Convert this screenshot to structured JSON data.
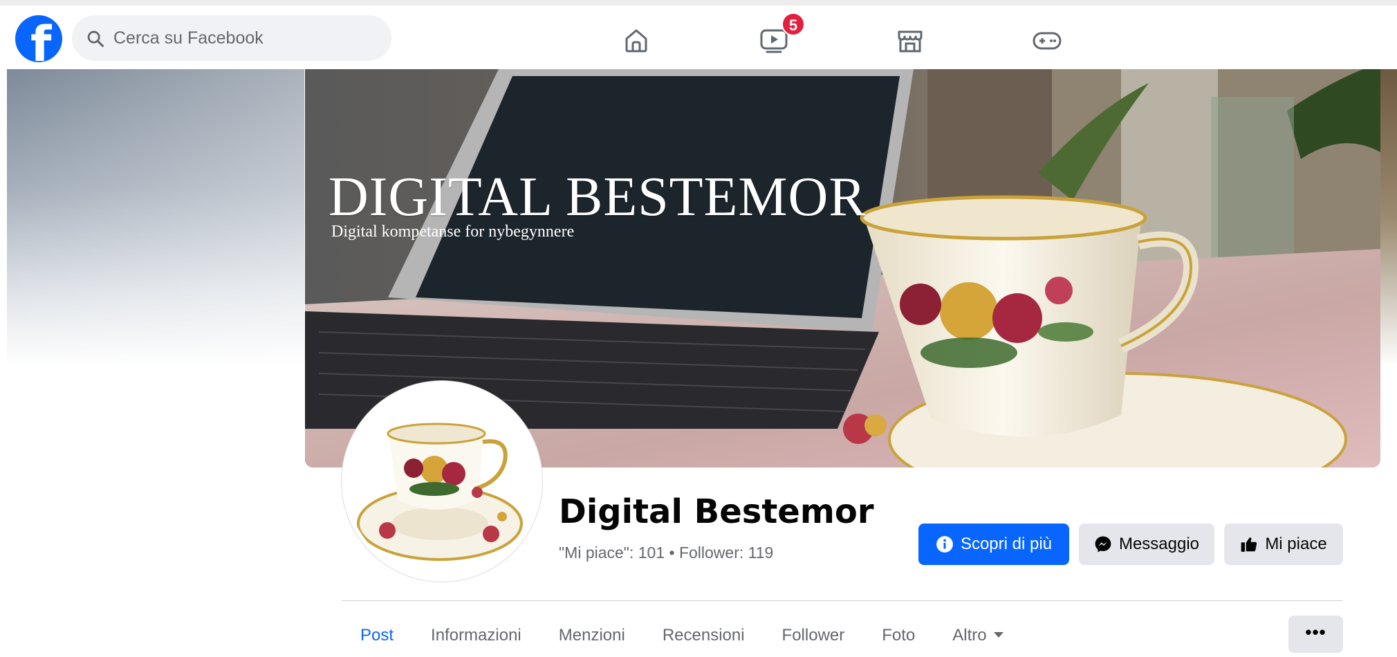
{
  "search": {
    "placeholder": "Cerca su Facebook"
  },
  "nav": {
    "icons": [
      "home-icon",
      "video-icon",
      "marketplace-icon",
      "gaming-icon"
    ],
    "video_badge": "5"
  },
  "cover": {
    "title": "DIGITAL BESTEMOR",
    "subtitle": "Digital kompetanse for nybegynnere"
  },
  "page": {
    "name": "Digital Bestemor",
    "stats": "\"Mi piace\": 101 • Follower: 119"
  },
  "actions": {
    "learn_more": "Scopri di più",
    "message": "Messaggio",
    "like": "Mi piace"
  },
  "tabs": [
    {
      "label": "Post"
    },
    {
      "label": "Informazioni"
    },
    {
      "label": "Menzioni"
    },
    {
      "label": "Recensioni"
    },
    {
      "label": "Follower"
    },
    {
      "label": "Foto"
    },
    {
      "label": "Altro"
    }
  ],
  "more_button": "•••",
  "colors": {
    "brand": "#0866ff",
    "badge": "#e41e3f",
    "secondary_button": "#e4e6eb",
    "muted_text": "#65676b"
  }
}
